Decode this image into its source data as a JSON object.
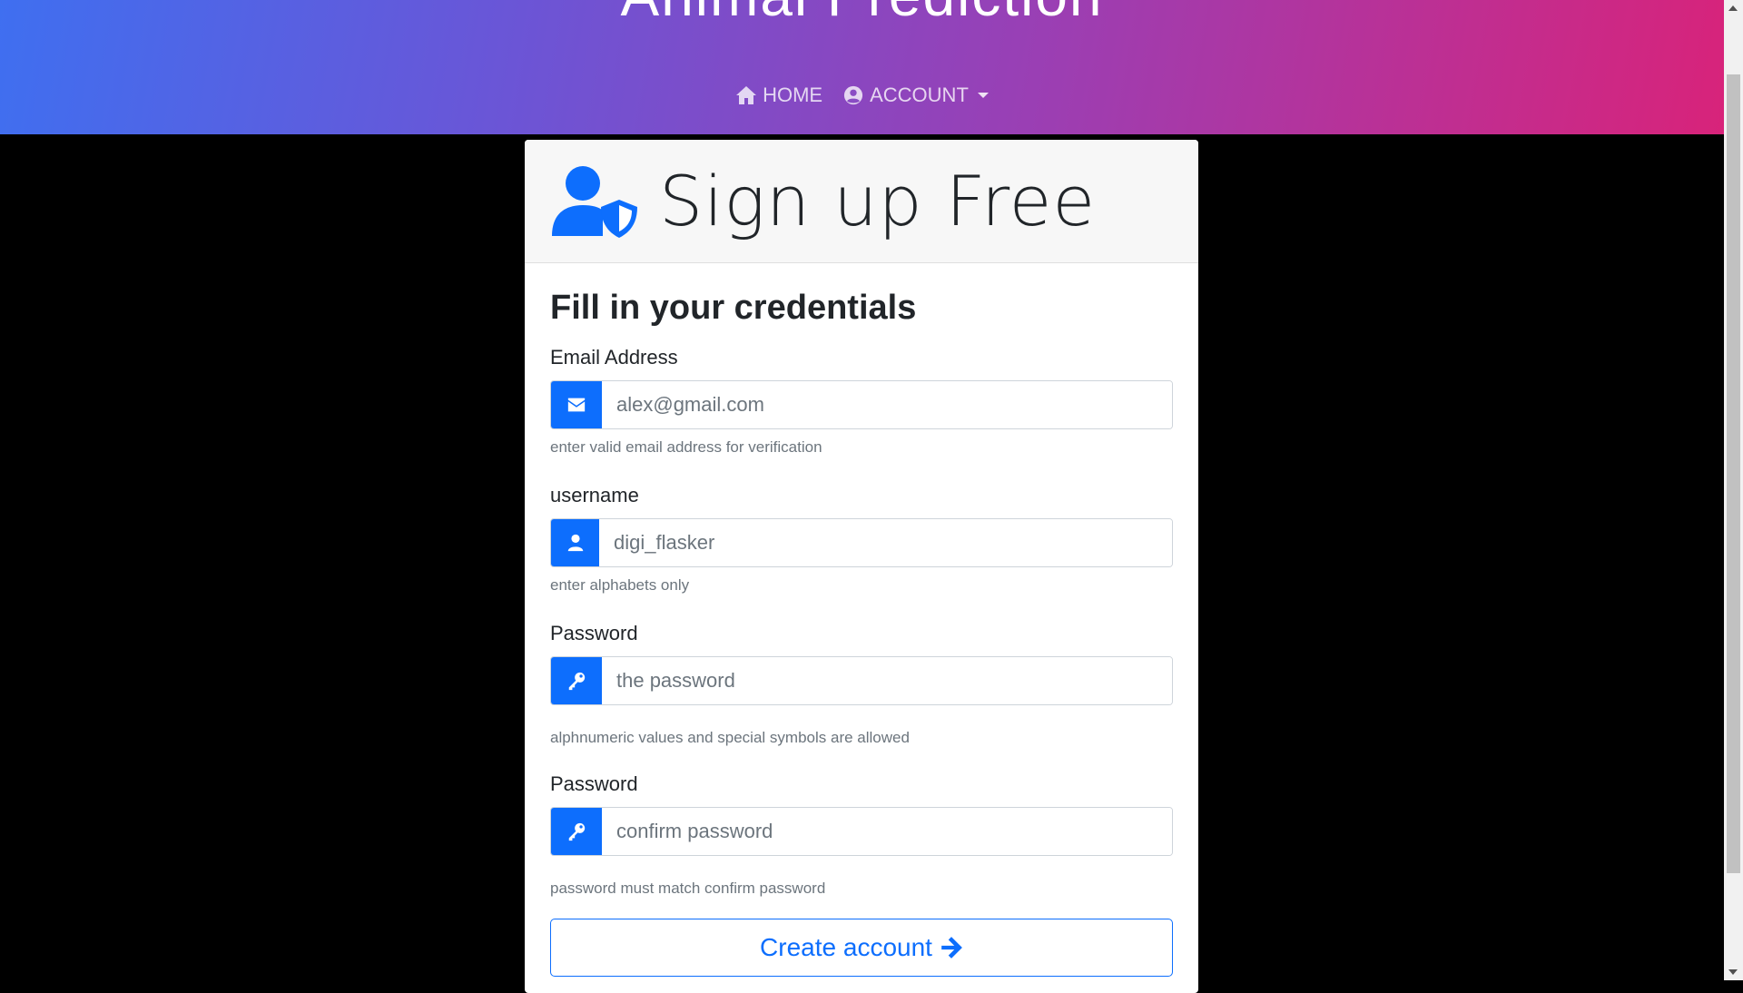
{
  "header": {
    "brand": "Animal Prediction",
    "nav": {
      "home_label": "HOME",
      "account_label": "ACCOUNT"
    }
  },
  "card": {
    "title": "Sign up Free",
    "section_title": "Fill in your credentials",
    "fields": {
      "email": {
        "label": "Email Address",
        "placeholder": "alex@gmail.com",
        "help": "enter valid email address for verification"
      },
      "username": {
        "label": "username",
        "placeholder": "digi_flasker",
        "help": "enter alphabets only"
      },
      "password": {
        "label": "Password",
        "placeholder": "the password",
        "help": "alphnumeric values and special symbols are allowed"
      },
      "confirm": {
        "label": "Password",
        "placeholder": "confirm password",
        "help": "password must match confirm password"
      }
    },
    "submit_label": "Create account"
  },
  "icons": {
    "home": "home-icon",
    "account": "user-circle-icon",
    "user_shield": "user-shield-icon",
    "email": "envelope-icon",
    "username": "user-icon",
    "password": "key-icon",
    "confirm": "key-icon",
    "submit": "arrow-right-icon"
  },
  "colors": {
    "primary": "#0d6efd",
    "header_gradient_start": "#3f6ff0",
    "header_gradient_end": "#d8237a"
  }
}
